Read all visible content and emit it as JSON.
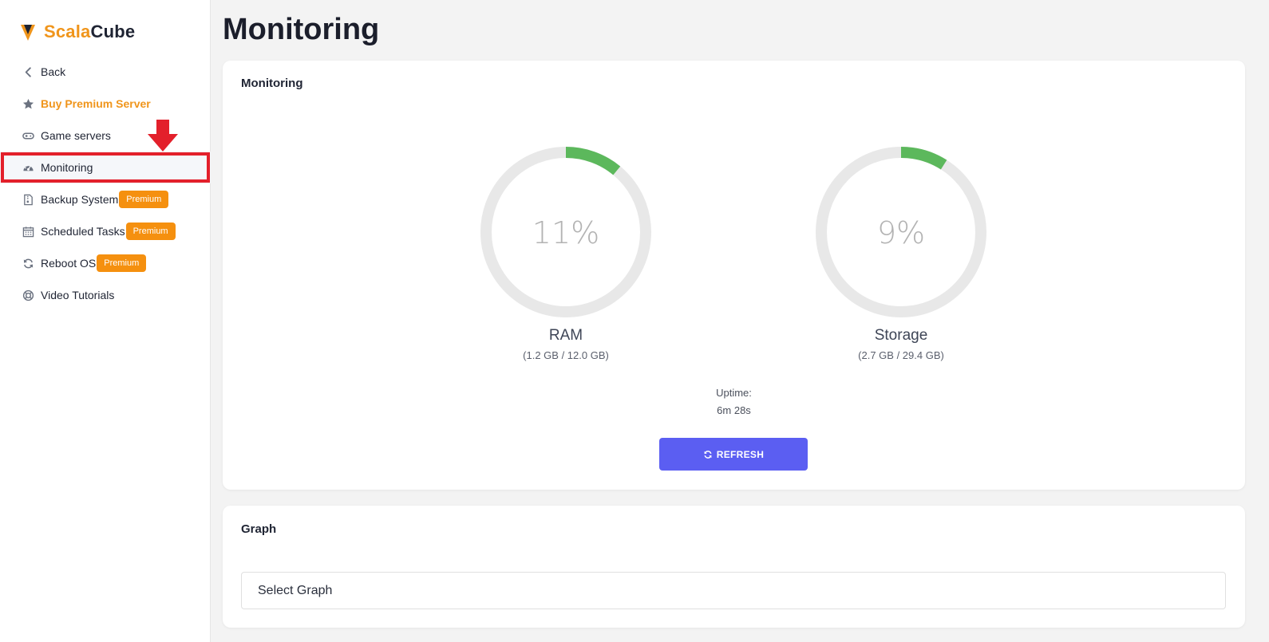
{
  "brand": {
    "name_part1": "Scala",
    "name_part2": "Cube",
    "accent_color": "#f0951b"
  },
  "sidebar": {
    "items": [
      {
        "label": "Back",
        "icon": "chevron-left-icon"
      },
      {
        "label": "Buy Premium Server",
        "icon": "star-icon"
      },
      {
        "label": "Game servers",
        "icon": "gamepad-icon"
      },
      {
        "label": "Monitoring",
        "icon": "dashboard-gauge-icon",
        "active": true
      },
      {
        "label": "Backup System",
        "icon": "file-archive-icon",
        "badge": "Premium"
      },
      {
        "label": "Scheduled Tasks",
        "icon": "calendar-icon",
        "badge": "Premium"
      },
      {
        "label": "Reboot OS",
        "icon": "sync-icon",
        "badge": "Premium"
      },
      {
        "label": "Video Tutorials",
        "icon": "lifebuoy-icon"
      }
    ]
  },
  "page": {
    "title": "Monitoring"
  },
  "monitoring_card": {
    "title": "Monitoring",
    "gauges": [
      {
        "percent_text": "11%",
        "percent": 11,
        "label": "RAM",
        "detail": "(1.2 GB / 12.0 GB)"
      },
      {
        "percent_text": "9%",
        "percent": 9,
        "label": "Storage",
        "detail": "(2.7 GB / 29.4 GB)"
      }
    ],
    "uptime_label": "Uptime:",
    "uptime_value": "6m 28s",
    "refresh_label": "REFRESH"
  },
  "graph_card": {
    "title": "Graph",
    "select_value": "Select Graph"
  },
  "colors": {
    "gauge_fill": "#5cb85c",
    "gauge_track": "#e8e8e8",
    "button": "#5b5ef2",
    "badge": "#f5900f",
    "highlight": "#e3202b"
  }
}
